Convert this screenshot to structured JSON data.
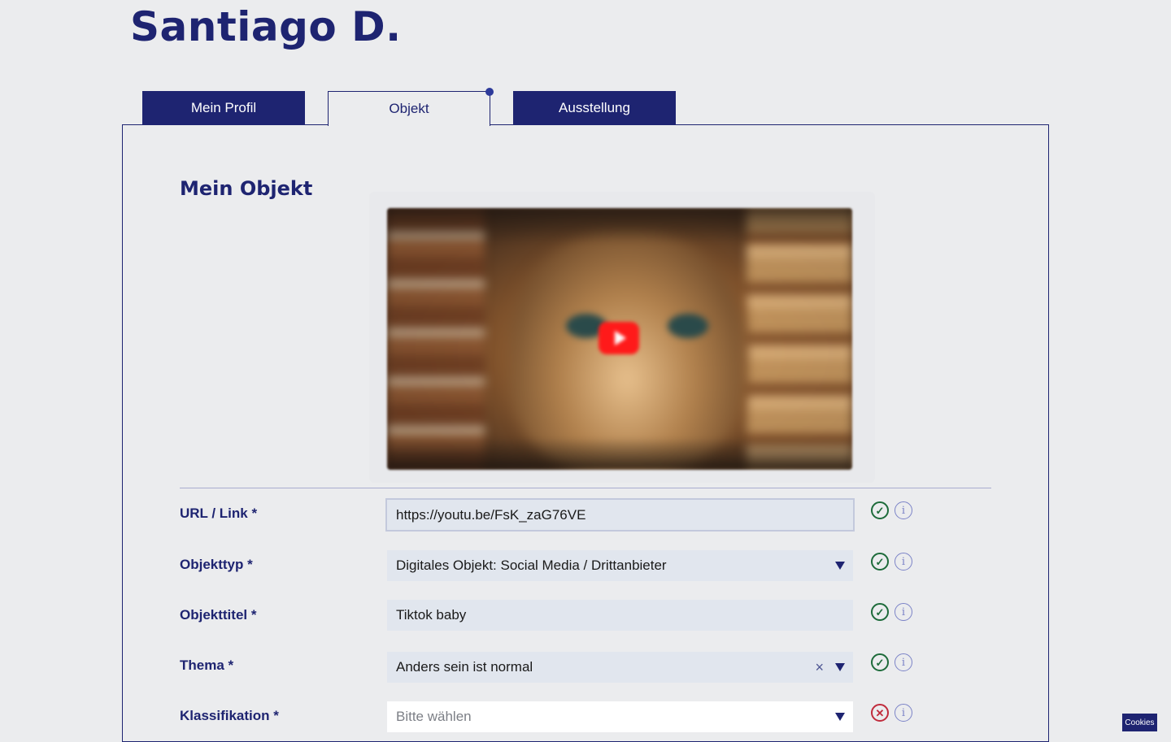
{
  "header": {
    "title": "Santiago D."
  },
  "tabs": [
    {
      "label": "Mein Profil",
      "active": false
    },
    {
      "label": "Objekt",
      "active": true
    },
    {
      "label": "Ausstellung",
      "active": false
    }
  ],
  "section": {
    "title": "Mein Objekt"
  },
  "colors": {
    "primary": "#1e2471",
    "field_bg": "#e1e6ee",
    "valid": "#1d6b3a",
    "invalid": "#c02b3c",
    "info": "#7b83c7"
  },
  "form": {
    "fields": [
      {
        "label": "URL / Link *",
        "value": "https://youtu.be/FsK_zaG76VE",
        "type": "text",
        "status": "valid"
      },
      {
        "label": "Objekttyp *",
        "value": "Digitales Objekt: Social Media / Drittanbieter",
        "type": "select",
        "status": "valid"
      },
      {
        "label": "Objekttitel *",
        "value": "Tiktok baby",
        "type": "text",
        "status": "valid"
      },
      {
        "label": "Thema *",
        "value": "Anders sein ist normal",
        "type": "select-clearable",
        "status": "valid"
      },
      {
        "label": "Klassifikation *",
        "placeholder": "Bitte wählen",
        "type": "select",
        "status": "invalid"
      }
    ],
    "status_icons": {
      "valid": "check-circle-icon",
      "invalid": "x-circle-icon",
      "info": "info-circle-icon"
    },
    "info_glyph": "i",
    "check_glyph": "✓",
    "cross_glyph": "✕",
    "clear_glyph": "×"
  },
  "footer": {
    "cookies_label": "Cookies"
  }
}
